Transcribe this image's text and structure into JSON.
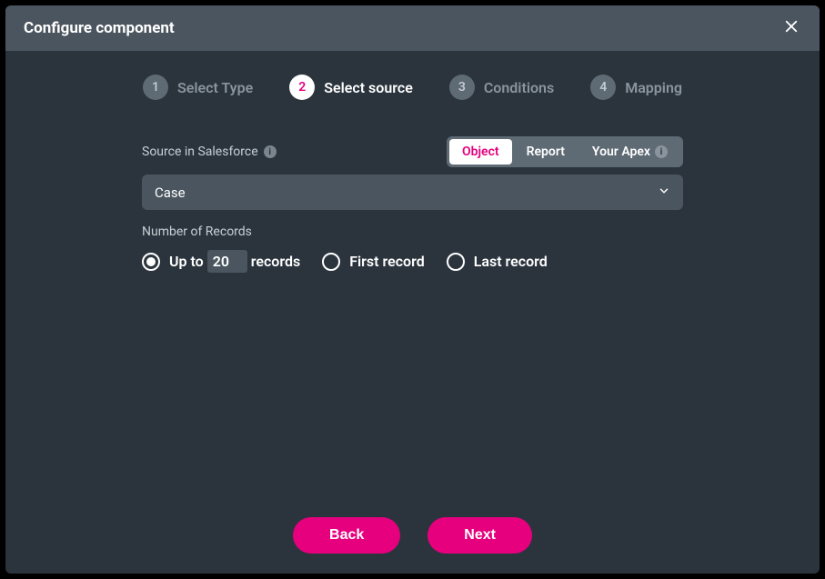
{
  "header": {
    "title": "Configure component"
  },
  "stepper": {
    "items": [
      {
        "num": "1",
        "label": "Select Type"
      },
      {
        "num": "2",
        "label": "Select source"
      },
      {
        "num": "3",
        "label": "Conditions"
      },
      {
        "num": "4",
        "label": "Mapping"
      }
    ],
    "active_index": 1
  },
  "source": {
    "label": "Source in Salesforce",
    "segmented": {
      "options": [
        {
          "label": "Object"
        },
        {
          "label": "Report"
        },
        {
          "label": "Your Apex",
          "has_info": true
        }
      ],
      "selected_index": 0
    },
    "select_value": "Case"
  },
  "records": {
    "label": "Number of Records",
    "options": {
      "upto_prefix": "Up to",
      "upto_value": "20",
      "upto_suffix": "records",
      "first": "First record",
      "last": "Last record"
    },
    "selected": "upto"
  },
  "footer": {
    "back": "Back",
    "next": "Next"
  }
}
